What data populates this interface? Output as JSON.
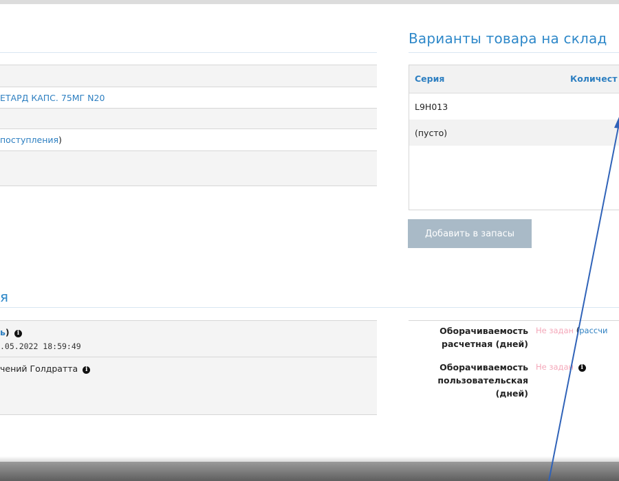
{
  "info_rows": [
    {
      "text": ""
    },
    {
      "text": "ЕТАРД КАПС. 75МГ N20",
      "kind": "link"
    },
    {
      "text": ""
    },
    {
      "text_link": " поступления",
      "text_suffix": ")"
    },
    {
      "text": ""
    }
  ],
  "variants": {
    "title": "Варианты товара на склад",
    "columns": [
      "Серия",
      "Количест"
    ],
    "rows": [
      "L9H013",
      "(пусто)"
    ],
    "add_button": "Добавить в запасы"
  },
  "section2": {
    "title": "я",
    "line1_prefix": "ь",
    "line1_suffix": ")",
    "line2": ".05.2022 18:59:49",
    "line3": "чений Голдратта"
  },
  "turnover": {
    "calculated_label": "Оборачиваемость расчетная (дней)",
    "calculated_value": "Не задан",
    "calculated_link": "рассчи",
    "user_label": "Оборачиваемость пользовательская (дней)",
    "user_value": "Не задан"
  },
  "colors": {
    "accent": "#2e88c9",
    "link": "#2d7fc1",
    "not_set": "#f4a7b9",
    "button": "#a9bac7"
  }
}
